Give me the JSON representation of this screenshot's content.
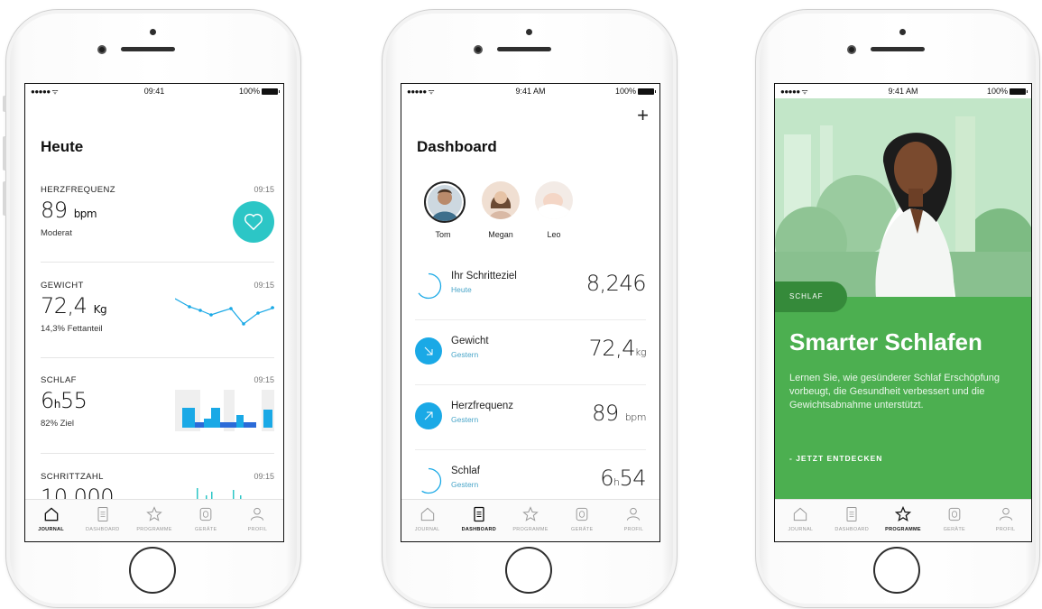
{
  "colors": {
    "accent_teal": "#2cc6c6",
    "accent_blue": "#1aa9e6",
    "green_card": "#4caf50",
    "green_tag": "#358a3a"
  },
  "tabs": [
    {
      "key": "journal",
      "label": "JOURNAL",
      "icon": "home-icon"
    },
    {
      "key": "dashboard",
      "label": "DASHBOARD",
      "icon": "document-icon"
    },
    {
      "key": "programme",
      "label": "PROGRAMME",
      "icon": "star-icon"
    },
    {
      "key": "geraete",
      "label": "GERÄTE",
      "icon": "watch-icon"
    },
    {
      "key": "profil",
      "label": "PROFIL",
      "icon": "person-icon"
    }
  ],
  "phone1": {
    "status": {
      "signal": "●●●●● ᯤ",
      "time": "09:41",
      "battery": "100%"
    },
    "title": "Heute",
    "metrics": [
      {
        "label": "HERZFREQUENZ",
        "time": "09:15",
        "value": "89",
        "unit": "bpm",
        "sub": "Moderat",
        "icon": "heart-icon"
      },
      {
        "label": "GEWICHT",
        "time": "09:15",
        "value": "72,4",
        "unit": "Kg",
        "sub": "14,3% Fettanteil"
      },
      {
        "label": "SCHLAF",
        "time": "09:15",
        "value": "6",
        "unit": "h",
        "value2": "55",
        "sub": "82% Ziel"
      },
      {
        "label": "SCHRITTZAHL",
        "time": "09:15",
        "value": "10.000",
        "unit": ""
      }
    ],
    "active_tab": "JOURNAL"
  },
  "phone2": {
    "status": {
      "signal": "●●●●● ᯤ",
      "time": "9:41 AM",
      "battery": "100%"
    },
    "plus": "+",
    "title": "Dashboard",
    "people": [
      {
        "name": "Tom"
      },
      {
        "name": "Megan"
      },
      {
        "name": "Leo"
      }
    ],
    "rows": [
      {
        "name": "Ihr Schritteziel",
        "date": "Heute",
        "value": "8,246",
        "unit": ""
      },
      {
        "name": "Gewicht",
        "date": "Gestern",
        "value": "72,4",
        "unit": "kg"
      },
      {
        "name": "Herzfrequenz",
        "date": "Gestern",
        "value": "89",
        "unit": "bpm"
      },
      {
        "name": "Schlaf",
        "date": "Gestern",
        "value": "6",
        "unit": "h",
        "value2": "54"
      }
    ],
    "active_tab": "DASHBOARD"
  },
  "phone3": {
    "status": {
      "signal": "●●●●● ᯤ",
      "time": "9:41 AM",
      "battery": "100%"
    },
    "tag": "SCHLAF",
    "heading": "Smarter Schlafen",
    "body": "Lernen Sie, wie gesünderer Schlaf Erschöpfung vorbeugt, die Gesundheit verbessert und die Gewichtsabnahme unterstützt.",
    "cta": "- JETZT ENTDECKEN",
    "active_tab": "PROGRAMME"
  }
}
